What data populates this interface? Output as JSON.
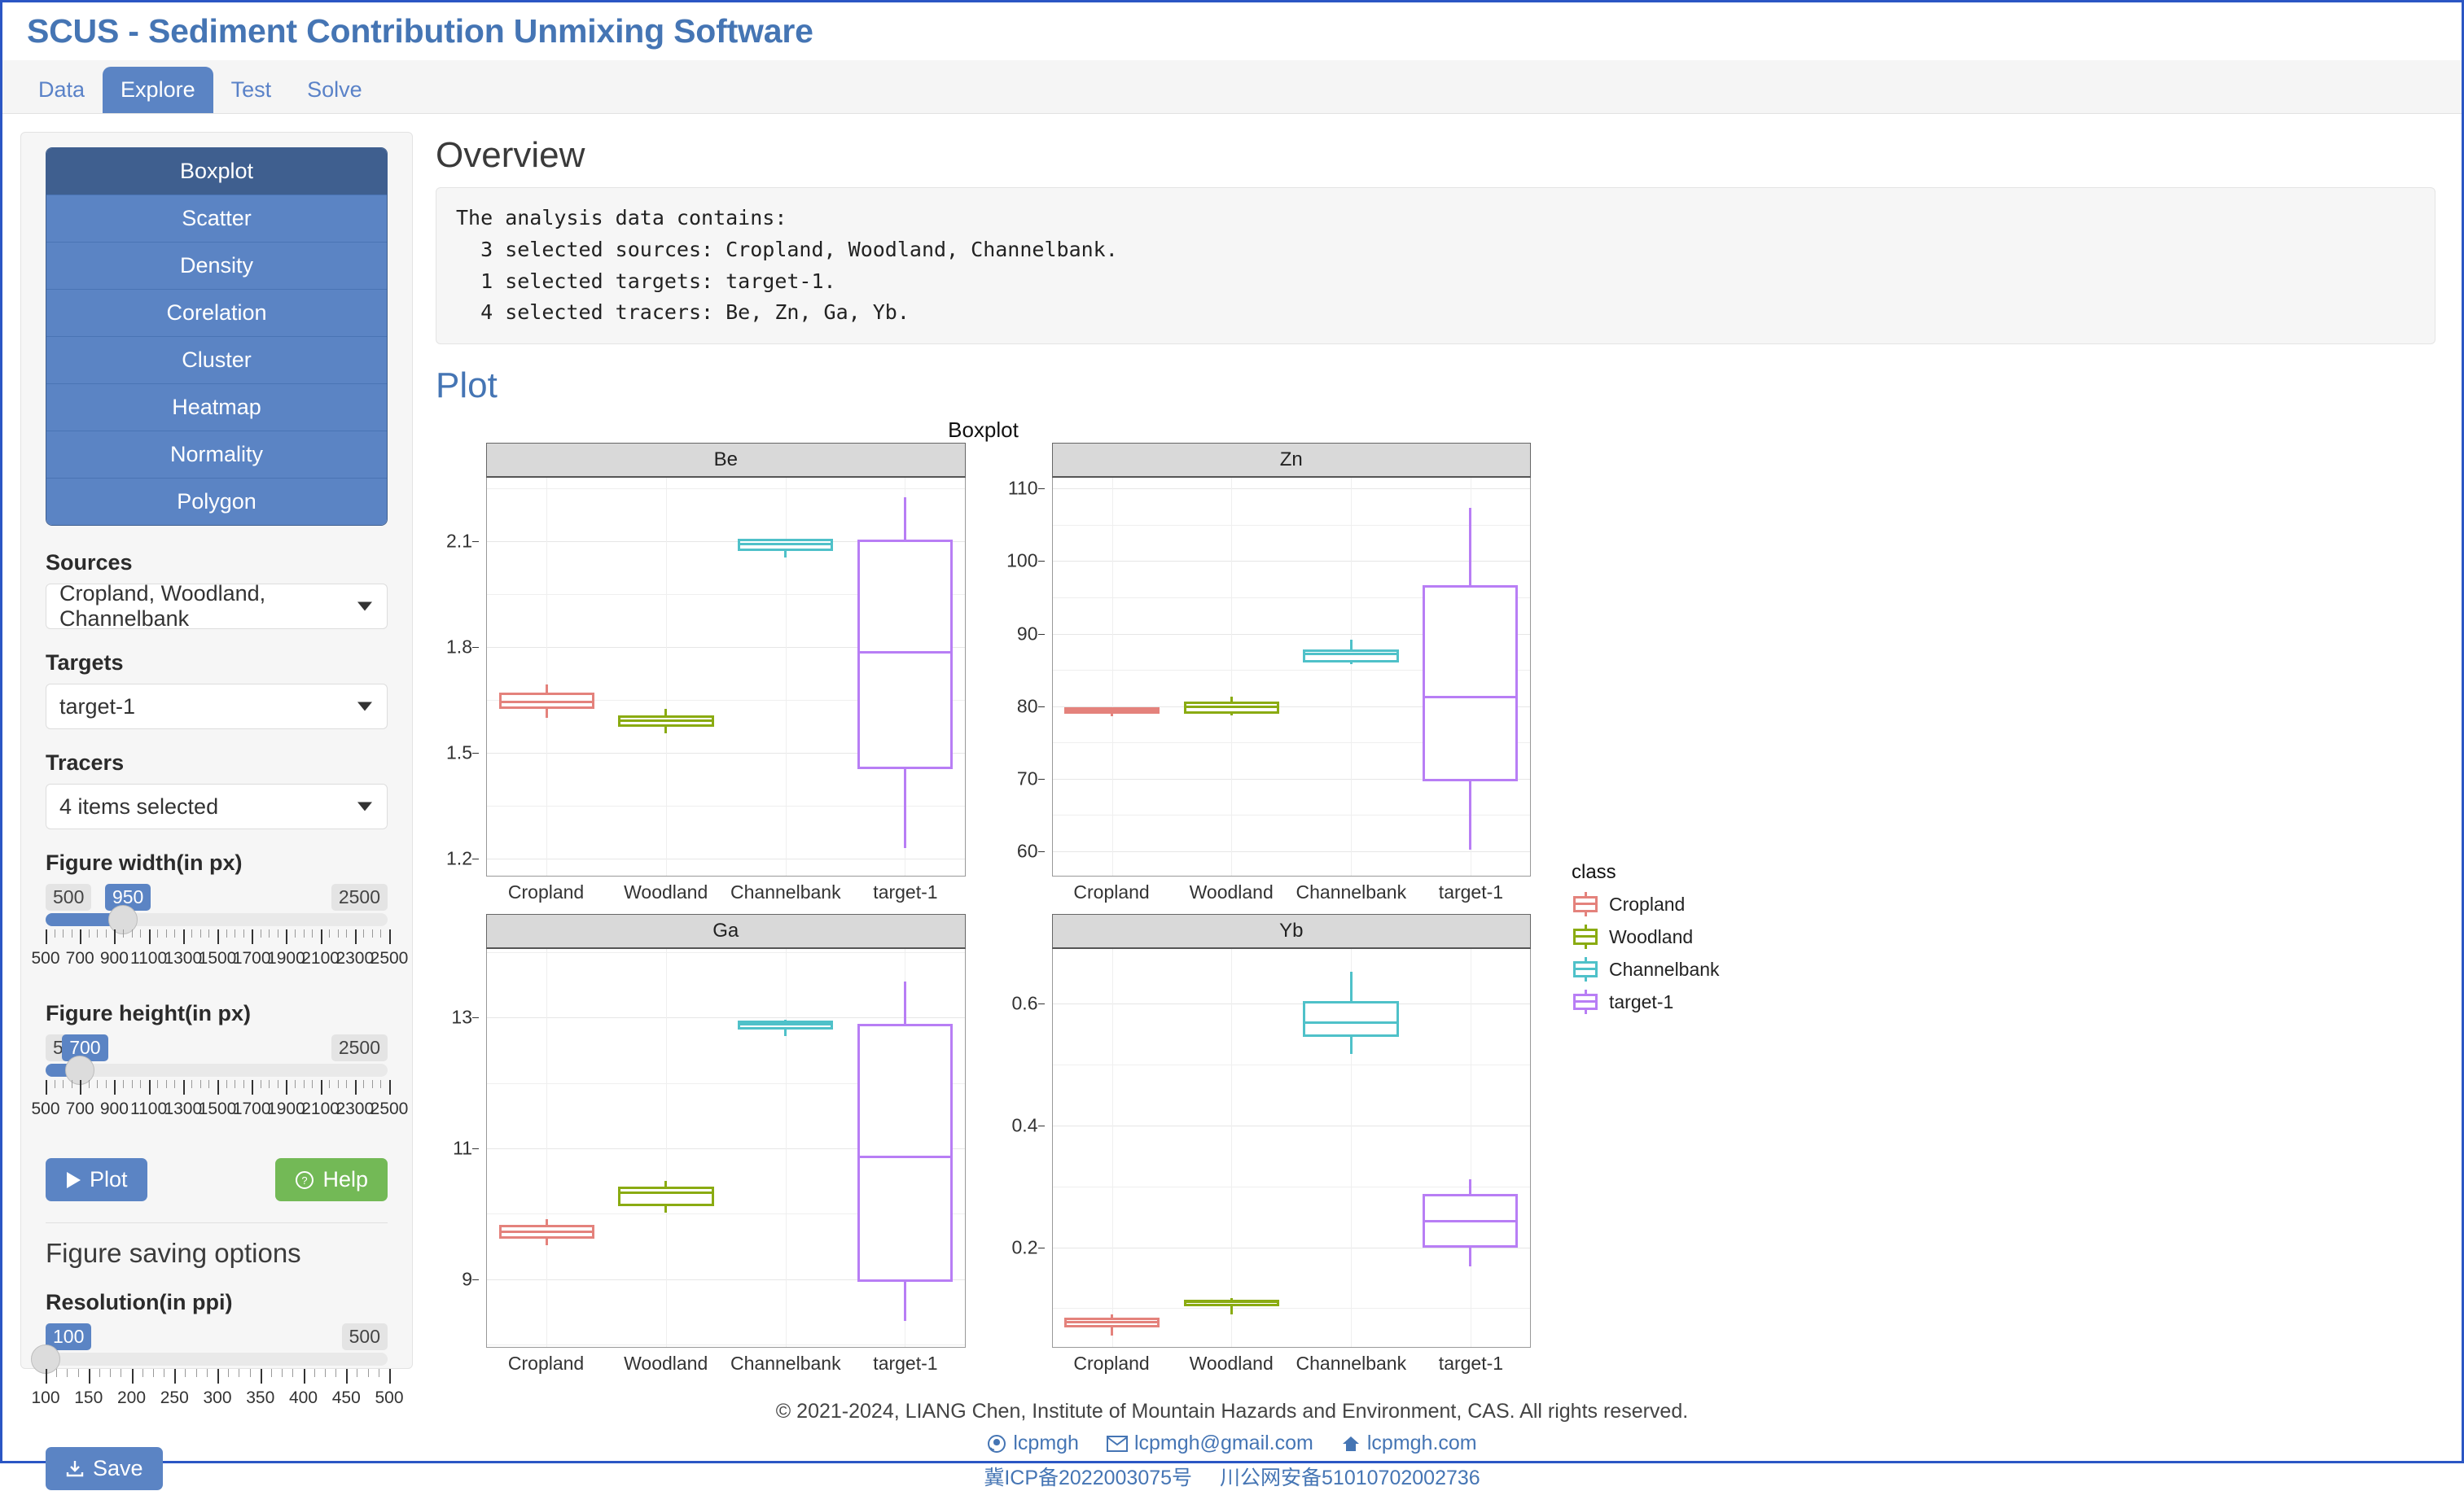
{
  "app": {
    "title": "SCUS - Sediment Contribution Unmixing Software"
  },
  "tabs": [
    {
      "label": "Data",
      "active": false
    },
    {
      "label": "Explore",
      "active": true
    },
    {
      "label": "Test",
      "active": false
    },
    {
      "label": "Solve",
      "active": false
    }
  ],
  "sidebar": {
    "nav": [
      {
        "label": "Boxplot",
        "active": true
      },
      {
        "label": "Scatter",
        "active": false
      },
      {
        "label": "Density",
        "active": false
      },
      {
        "label": "Corelation",
        "active": false
      },
      {
        "label": "Cluster",
        "active": false
      },
      {
        "label": "Heatmap",
        "active": false
      },
      {
        "label": "Normality",
        "active": false
      },
      {
        "label": "Polygon",
        "active": false
      }
    ],
    "sources": {
      "label": "Sources",
      "value": "Cropland, Woodland, Channelbank"
    },
    "targets": {
      "label": "Targets",
      "value": "target-1"
    },
    "tracers": {
      "label": "Tracers",
      "value": "4 items selected"
    },
    "figure_width": {
      "label": "Figure width(in px)",
      "min_label": "500",
      "max_label": "2500",
      "value_label": "950",
      "min": 500,
      "max": 2500,
      "value": 950,
      "ticks": [
        "500",
        "700",
        "900",
        "1100",
        "1300",
        "1500",
        "1700",
        "1900",
        "2100",
        "2300",
        "2500"
      ]
    },
    "figure_height": {
      "label": "Figure height(in px)",
      "min_label": "500",
      "max_label": "2500",
      "value_label": "700",
      "min": 500,
      "max": 2500,
      "value": 700,
      "ticks": [
        "500",
        "700",
        "900",
        "1100",
        "1300",
        "1500",
        "1700",
        "1900",
        "2100",
        "2300",
        "2500"
      ]
    },
    "plot_button": "Plot",
    "help_button": "Help",
    "saving_title": "Figure saving options",
    "resolution": {
      "label": "Resolution(in ppi)",
      "min_label": "100",
      "max_label": "500",
      "value_label": "100",
      "min": 100,
      "max": 500,
      "value": 100,
      "ticks": [
        "100",
        "150",
        "200",
        "250",
        "300",
        "350",
        "400",
        "450",
        "500"
      ]
    },
    "save_button": "Save"
  },
  "main": {
    "overview_heading": "Overview",
    "overview_text": "The analysis data contains:\n  3 selected sources: Cropland, Woodland, Channelbank.\n  1 selected targets: target-1.\n  4 selected tracers: Be, Zn, Ga, Yb.",
    "plot_heading": "Plot"
  },
  "chart_data": {
    "type": "boxplot",
    "title": "Boxplot",
    "categories": [
      "Cropland",
      "Woodland",
      "Channelbank",
      "target-1"
    ],
    "legend": {
      "title": "class",
      "entries": [
        {
          "label": "Cropland",
          "color": "#e4827c"
        },
        {
          "label": "Woodland",
          "color": "#8aab12"
        },
        {
          "label": "Channelbank",
          "color": "#4fc1c9"
        },
        {
          "label": "target-1",
          "color": "#b87ef5"
        }
      ]
    },
    "panels": [
      {
        "name": "Be",
        "ylim": [
          1.15,
          2.28
        ],
        "yticks": [
          1.2,
          1.5,
          1.8,
          2.1
        ],
        "ytick_labels": [
          "1.2",
          "1.5",
          "1.8",
          "2.1"
        ],
        "boxes": [
          {
            "class": "Cropland",
            "color": "#e4827c",
            "min": 1.6,
            "q1": 1.625,
            "median": 1.645,
            "q3": 1.672,
            "max": 1.695
          },
          {
            "class": "Woodland",
            "color": "#8aab12",
            "min": 1.555,
            "q1": 1.575,
            "median": 1.592,
            "q3": 1.607,
            "max": 1.625
          },
          {
            "class": "Channelbank",
            "color": "#4fc1c9",
            "min": 2.055,
            "q1": 2.072,
            "median": 2.092,
            "q3": 2.108,
            "max": 2.108
          },
          {
            "class": "target-1",
            "color": "#b87ef5",
            "min": 1.23,
            "q1": 1.455,
            "median": 1.785,
            "q3": 2.105,
            "max": 2.225
          }
        ]
      },
      {
        "name": "Zn",
        "ylim": [
          56.5,
          111.5
        ],
        "yticks": [
          60,
          70,
          80,
          90,
          100,
          110
        ],
        "ytick_labels": [
          "60",
          "70",
          "80",
          "90",
          "100",
          "110"
        ],
        "boxes": [
          {
            "class": "Cropland",
            "color": "#e4827c",
            "min": 78.6,
            "q1": 79.0,
            "median": 79.4,
            "q3": 79.8,
            "max": 79.9
          },
          {
            "class": "Woodland",
            "color": "#8aab12",
            "min": 78.7,
            "q1": 79.0,
            "median": 79.9,
            "q3": 80.6,
            "max": 81.3
          },
          {
            "class": "Channelbank",
            "color": "#4fc1c9",
            "min": 85.8,
            "q1": 86.0,
            "median": 87.2,
            "q3": 87.8,
            "max": 89.2
          },
          {
            "class": "target-1",
            "color": "#b87ef5",
            "min": 60.2,
            "q1": 69.6,
            "median": 81.3,
            "q3": 96.7,
            "max": 107.3
          }
        ]
      },
      {
        "name": "Ga",
        "ylim": [
          7.95,
          14.05
        ],
        "yticks": [
          9,
          11,
          13
        ],
        "ytick_labels": [
          "9",
          "11",
          "13"
        ],
        "boxes": [
          {
            "class": "Cropland",
            "color": "#e4827c",
            "min": 9.52,
            "q1": 9.62,
            "median": 9.72,
            "q3": 9.83,
            "max": 9.92
          },
          {
            "class": "Woodland",
            "color": "#8aab12",
            "min": 10.02,
            "q1": 10.12,
            "median": 10.32,
            "q3": 10.41,
            "max": 10.5
          },
          {
            "class": "Channelbank",
            "color": "#4fc1c9",
            "min": 12.72,
            "q1": 12.82,
            "median": 12.9,
            "q3": 12.95,
            "max": 12.97
          },
          {
            "class": "target-1",
            "color": "#b87ef5",
            "min": 8.36,
            "q1": 8.96,
            "median": 10.87,
            "q3": 12.91,
            "max": 13.55
          }
        ]
      },
      {
        "name": "Yb",
        "ylim": [
          0.035,
          0.69
        ],
        "yticks": [
          0.2,
          0.4,
          0.6
        ],
        "ytick_labels": [
          "0.2",
          "0.4",
          "0.6"
        ],
        "boxes": [
          {
            "class": "Cropland",
            "color": "#e4827c",
            "min": 0.055,
            "q1": 0.068,
            "median": 0.077,
            "q3": 0.085,
            "max": 0.09
          },
          {
            "class": "Woodland",
            "color": "#8aab12",
            "min": 0.09,
            "q1": 0.103,
            "median": 0.11,
            "q3": 0.114,
            "max": 0.116
          },
          {
            "class": "Channelbank",
            "color": "#4fc1c9",
            "min": 0.518,
            "q1": 0.545,
            "median": 0.569,
            "q3": 0.604,
            "max": 0.652
          },
          {
            "class": "target-1",
            "color": "#b87ef5",
            "min": 0.168,
            "q1": 0.2,
            "median": 0.243,
            "q3": 0.288,
            "max": 0.312
          }
        ]
      }
    ]
  },
  "footer": {
    "copyright": "© 2021-2024, LIANG Chen, Institute of Mountain Hazards and Environment, CAS. All rights reserved.",
    "links": [
      {
        "icon": "github-icon",
        "label": "lcpmgh"
      },
      {
        "icon": "envelope-icon",
        "label": "lcpmgh@gmail.com"
      },
      {
        "icon": "home-icon",
        "label": "lcpmgh.com"
      }
    ],
    "icp": [
      {
        "label": "冀ICP备2022003075号"
      },
      {
        "label": "川公网安备51010702002736"
      }
    ]
  }
}
